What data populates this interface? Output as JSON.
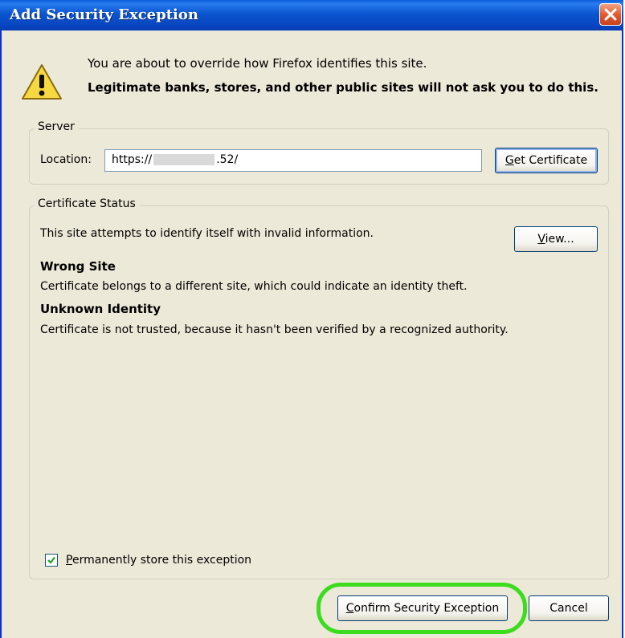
{
  "window": {
    "title": "Add Security Exception"
  },
  "warning": {
    "line1": "You are about to override how Firefox identifies this site.",
    "line2": "Legitimate banks, stores, and other public sites will not ask you to do this."
  },
  "server": {
    "group_label": "Server",
    "location_label": "Location:",
    "location_value_prefix": "https://",
    "location_value_suffix": ".52/",
    "get_certificate_accel": "G",
    "get_certificate_rest": "et Certificate"
  },
  "status": {
    "group_label": "Certificate Status",
    "summary": "This site attempts to identify itself with invalid information.",
    "view_accel": "V",
    "view_rest": "iew...",
    "wrong_site_heading": "Wrong Site",
    "wrong_site_desc": "Certificate belongs to a different site, which could indicate an identity theft.",
    "unknown_identity_heading": "Unknown Identity",
    "unknown_identity_desc": "Certificate is not trusted, because it hasn't been verified by a recognized authority.",
    "permanent_accel": "P",
    "permanent_rest": "ermanently store this exception",
    "permanent_checked": true
  },
  "actions": {
    "confirm_accel": "C",
    "confirm_rest": "onfirm Security Exception",
    "cancel_label": "Cancel"
  },
  "colors": {
    "titlebar": "#0a55d0",
    "highlight": "#3cdc1e",
    "dialog_bg": "#ece9d8"
  }
}
